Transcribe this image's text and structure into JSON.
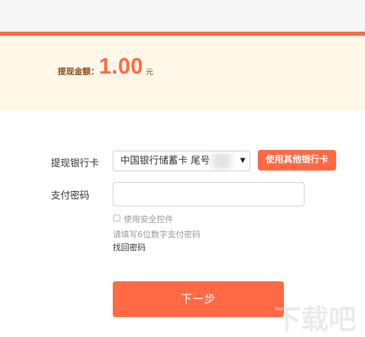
{
  "amount": {
    "label": "提现金额：",
    "value": "1.00",
    "unit": "元"
  },
  "form": {
    "bank_label": "提现银行卡",
    "bank_selected": "中国银行储蓄卡 尾号",
    "other_bank_label": "使用其他银行卡",
    "password_label": "支付密码",
    "password_value": "",
    "secure_control_label": "使用安全控件",
    "password_hint": "请填写6位数字支付密码",
    "recover_password_label": "找回密码",
    "next_label": "下一步"
  },
  "watermark": {
    "text": "下载吧"
  },
  "colors": {
    "accent": "#ff6a45",
    "panel_bg": "#fff8e8",
    "hint_text": "#999999"
  },
  "icons": {
    "dropdown": "caret-down-icon"
  }
}
